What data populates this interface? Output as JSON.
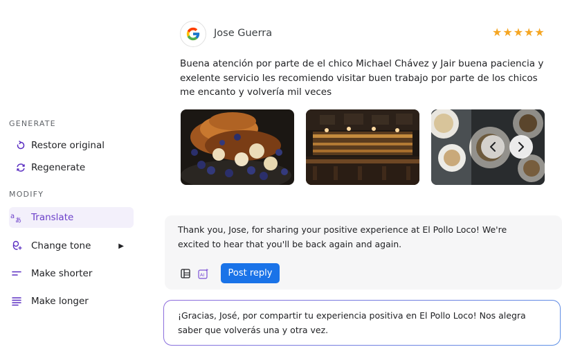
{
  "menu": {
    "generate_label": "GENERATE",
    "modify_label": "MODIFY",
    "items": [
      {
        "label": "Restore original",
        "icon": "restore-icon"
      },
      {
        "label": "Regenerate",
        "icon": "regenerate-icon"
      },
      {
        "label": "Translate",
        "icon": "translate-icon",
        "active": true
      },
      {
        "label": "Change tone",
        "icon": "tone-icon"
      },
      {
        "label": "Make shorter",
        "icon": "make-shorter-icon"
      },
      {
        "label": "Make longer",
        "icon": "make-longer-icon"
      }
    ]
  },
  "review": {
    "source_icon": "google-icon",
    "author": "Jose Guerra",
    "rating": 5,
    "stars": "★★★★★",
    "text": "Buena atención por parte de el chico Michael Chávez y Jair buena paciencia y exelente servicio les recomiendo visitar buen trabajo por parte de los chicos me encanto y volvería mil veces",
    "photos": [
      "french-toast-photo",
      "bar-interior-photo",
      "table-dishes-photo"
    ]
  },
  "reply": {
    "text": "Thank you, Jose, for sharing your positive experience at El Pollo Loco! We're excited to hear that you'll be back again and again.",
    "post_label": "Post reply"
  },
  "translation": {
    "text": "¡Gracias, José, por compartir tu experiencia positiva en El Pollo Loco! Nos alegra saber que volverás una y otra vez."
  },
  "colors": {
    "accent_purple": "#6b3fc9",
    "primary_blue": "#1a73e8",
    "star": "#f5a623"
  }
}
